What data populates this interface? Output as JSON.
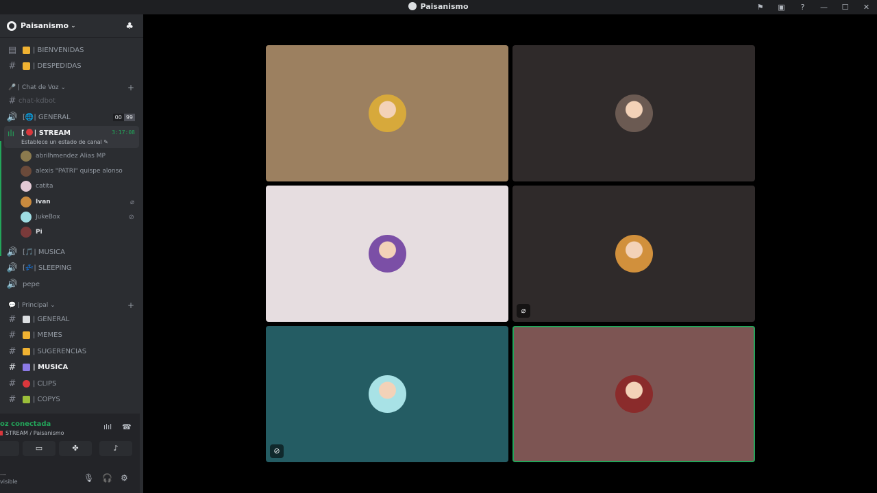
{
  "window": {
    "title": "Paisanismo",
    "icons": {
      "flag": "⚑",
      "inbox": "▣",
      "help": "?",
      "minimize": "—",
      "maximize": "☐",
      "close": "✕"
    }
  },
  "server": {
    "name": "Paisanismo",
    "chevron": "⌄",
    "add_people_icon": "♣"
  },
  "text_channels_top": [
    {
      "icon": "▤",
      "emoji_color": "#f0b232",
      "label": "| BIENVENIDAS"
    },
    {
      "icon": "#",
      "emoji_color": "#f0b232",
      "label": "| DESPEDIDAS"
    }
  ],
  "voice_category": {
    "label": "🎤 | Chat de Voz ⌄",
    "plus": "+"
  },
  "voice_channels": {
    "kdbot": {
      "icon": "#",
      "label": "chat-kdbot"
    },
    "general": {
      "icon": "🔊",
      "label": "[🌐| GENERAL",
      "counter_a": "00",
      "counter_b": "99"
    },
    "stream": {
      "icon": "ılı",
      "label": "STREAM",
      "prefix": "[",
      "timer": "3:17:08",
      "status": "Establece un estado de canal ✎"
    },
    "musica": {
      "icon": "🔊",
      "label": "[🎵| MUSICA"
    },
    "sleeping": {
      "icon": "🔊",
      "label": "[💤| SLEEPING"
    },
    "pepe": {
      "icon": "🔊",
      "label": "pepe"
    }
  },
  "voice_users": [
    {
      "name": "abrilhmendez Alias MP",
      "avatar_color": "#8b7a4e",
      "status_icon": "",
      "bold": false
    },
    {
      "name": "alexis \"PATRI\" quispe alonso",
      "avatar_color": "#6b4a3a",
      "status_icon": "",
      "bold": false
    },
    {
      "name": "catita",
      "avatar_color": "#e3c9d4",
      "status_icon": "",
      "bold": false
    },
    {
      "name": "Ivan",
      "avatar_color": "#c98a3e",
      "status_icon": "⌀",
      "bold": true
    },
    {
      "name": "JukeBox",
      "avatar_color": "#9fdde3",
      "status_icon": "⊘",
      "bold": false
    },
    {
      "name": "Pi",
      "avatar_color": "#7a3a3a",
      "status_icon": "",
      "bold": true
    }
  ],
  "principal_category": {
    "label": "💬 | Principal ⌄",
    "plus": "+"
  },
  "principal_channels": [
    {
      "emoji_color": "#dbdee1",
      "label": "| GENERAL",
      "bold": false
    },
    {
      "emoji_color": "#f0b232",
      "label": "| MEMES",
      "bold": false
    },
    {
      "emoji_color": "#f0b232",
      "label": "| SUGERENCIAS",
      "bold": false
    },
    {
      "emoji_color": "#8c7ae6",
      "label": "| MUSICA",
      "bold": true
    },
    {
      "emoji_color": "#da373c",
      "label": "| CLIPS",
      "bold": false
    },
    {
      "emoji_color": "#9bbf3a",
      "label": "| COPYS",
      "bold": false
    }
  ],
  "voice_panel": {
    "status": "oz conectada",
    "sub": "STREAM / Paisanismo",
    "wave_icon": "ılıl",
    "hangup_icon": "☎",
    "btn_screen": "▭",
    "btn_activities": "✤",
    "btn_soundboard": "♪"
  },
  "user_area": {
    "name": "...",
    "status": "visible",
    "mic_icon": "🎙",
    "headset_icon": "🎧",
    "settings_icon": "⚙"
  },
  "tiles": [
    {
      "bg": "#9c8060",
      "avatar": "#d7a93b",
      "mute": "",
      "speaking": false
    },
    {
      "bg": "#2f2a2a",
      "avatar": "#6b5a52",
      "mute": "",
      "speaking": false
    },
    {
      "bg": "#e6dde0",
      "avatar": "#7b4fa6",
      "mute": "",
      "speaking": false
    },
    {
      "bg": "#2f2a2a",
      "avatar": "#d1903c",
      "mute": "⌀",
      "speaking": false
    },
    {
      "bg": "#245c63",
      "avatar": "#a8e2e6",
      "mute": "⊘",
      "speaking": false
    },
    {
      "bg": "#7d5553",
      "avatar": "#8a2b2b",
      "mute": "",
      "speaking": true
    }
  ]
}
